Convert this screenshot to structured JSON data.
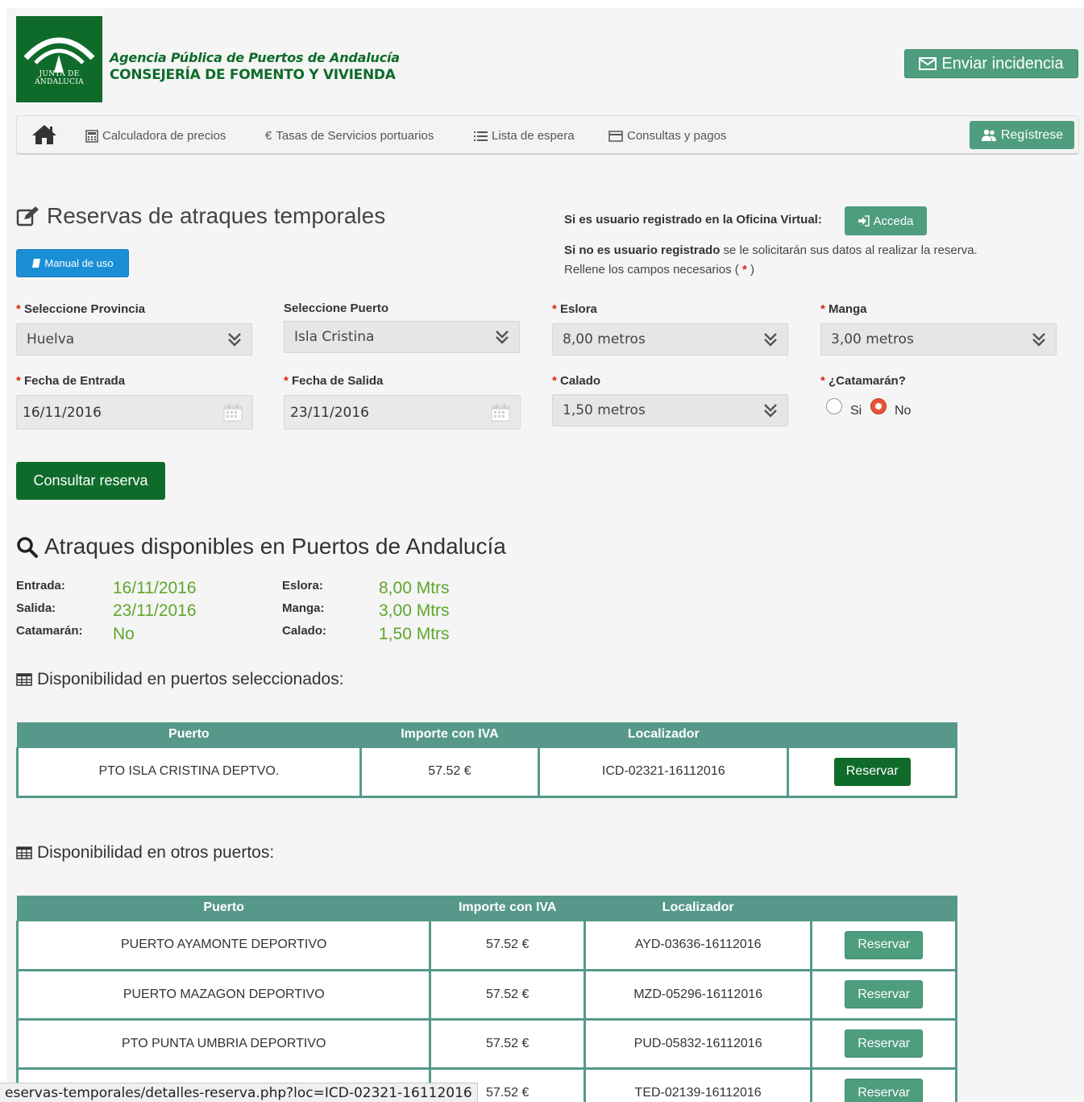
{
  "header": {
    "logo_text": "JUNTA DE ANDALUCIA",
    "agency_line1": "Agencia Pública de Puertos de Andalucía",
    "agency_line2": "CONSEJERÍA DE FOMENTO Y VIVIENDA",
    "incidencia_label": "Enviar incidencia"
  },
  "nav": {
    "items": [
      {
        "label": "Calculadora de precios",
        "icon": "calculator-icon"
      },
      {
        "label": "Tasas de Servicios portuarios",
        "icon": "euro-icon"
      },
      {
        "label": "Lista de espera",
        "icon": "list-icon"
      },
      {
        "label": "Consultas y pagos",
        "icon": "credit-card-icon"
      }
    ],
    "euro_symbol": "€",
    "registrese_label": "Regístrese"
  },
  "intro": {
    "title": "Reservas de atraques temporales",
    "manual_label": "Manual de uso",
    "registered_text": "Si es usuario registrado en la Oficina Virtual:",
    "acceda_label": "Acceda",
    "unregistered_bold": "Si no es usuario registrado",
    "unregistered_rest": " se le solicitarán sus datos al realizar la reserva.",
    "required_text_pre": "Rellene los campos necesarios (",
    "required_star": "*",
    "required_text_post": " )"
  },
  "form": {
    "provincia_label": "Seleccione Provincia",
    "provincia_value": "Huelva",
    "puerto_label": "Seleccione Puerto",
    "puerto_value": "Isla Cristina",
    "eslora_label": "Eslora",
    "eslora_value": "8,00 metros",
    "manga_label": "Manga",
    "manga_value": "3,00 metros",
    "entrada_label": "Fecha de Entrada",
    "entrada_value": "16/11/2016",
    "salida_label": "Fecha de Salida",
    "salida_value": "23/11/2016",
    "calado_label": "Calado",
    "calado_value": "1,50 metros",
    "catamaran_label": "¿Catamarán?",
    "radio_si": "Si",
    "radio_no": "No",
    "catamaran_selected": "No",
    "consultar_label": "Consultar reserva"
  },
  "summary": {
    "title": "Atraques disponibles en Puertos de Andalucía",
    "entrada_label": "Entrada:",
    "entrada_value": "16/11/2016",
    "salida_label": "Salida:",
    "salida_value": "23/11/2016",
    "catamaran_label": "Catamarán:",
    "catamaran_value": "No",
    "eslora_label": "Eslora:",
    "eslora_value": "8,00 Mtrs",
    "manga_label": "Manga:",
    "manga_value": "3,00 Mtrs",
    "calado_label": "Calado:",
    "calado_value": "1,50 Mtrs"
  },
  "selected_ports": {
    "title": "Disponibilidad en puertos seleccionados:",
    "columns": [
      "Puerto",
      "Importe con IVA",
      "Localizador"
    ],
    "rows": [
      {
        "puerto": "PTO ISLA CRISTINA DEPTVO.",
        "importe": "57.52 €",
        "localizador": "ICD-02321-16112016",
        "action": "Reservar"
      }
    ]
  },
  "other_ports": {
    "title": "Disponibilidad en otros puertos:",
    "columns": [
      "Puerto",
      "Importe con IVA",
      "Localizador"
    ],
    "rows": [
      {
        "puerto": "PUERTO AYAMONTE DEPORTIVO",
        "importe": "57.52 €",
        "localizador": "AYD-03636-16112016",
        "action": "Reservar"
      },
      {
        "puerto": "PUERTO MAZAGON DEPORTIVO",
        "importe": "57.52 €",
        "localizador": "MZD-05296-16112016",
        "action": "Reservar"
      },
      {
        "puerto": "PTO PUNTA UMBRIA DEPORTIVO",
        "importe": "57.52 €",
        "localizador": "PUD-05832-16112016",
        "action": "Reservar"
      },
      {
        "puerto": "",
        "importe": "57.52 €",
        "localizador": "TED-02139-16112016",
        "action": "Reservar"
      }
    ]
  },
  "statusbar": {
    "url": "eservas-temporales/detalles-reserva.php?loc=ICD-02321-16112016"
  },
  "colors": {
    "brand_green": "#0f6b2a",
    "teal": "#4e9d7f",
    "table_header": "#56998a",
    "value_green": "#5fa62a",
    "required_red": "#d9230f",
    "manual_blue": "#1a8fd6"
  }
}
